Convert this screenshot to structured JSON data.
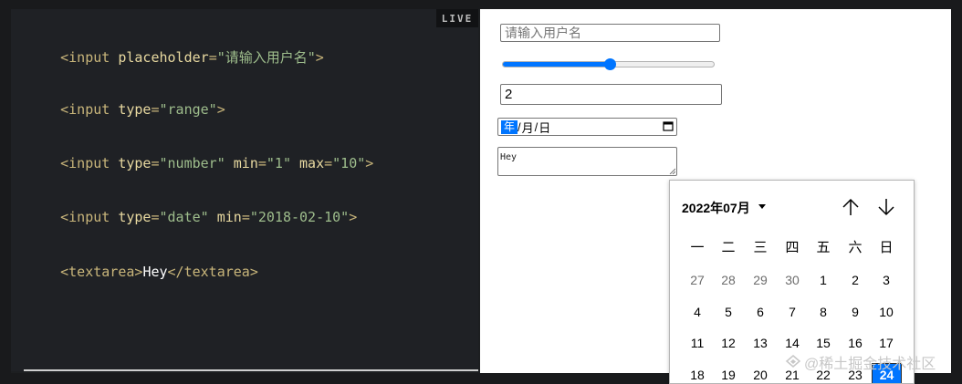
{
  "editor": {
    "lines": [
      {
        "open": "<input ",
        "attr1": "placeholder",
        "eq1": "=",
        "val1": "\"请输入用户名\"",
        "attr2": "",
        "eq2": "",
        "val2": "",
        "attr3": "",
        "eq3": "",
        "val3": "",
        "close": ">"
      },
      {
        "open": "<input ",
        "attr1": "type",
        "eq1": "=",
        "val1": "\"range\"",
        "attr2": "",
        "eq2": "",
        "val2": "",
        "attr3": "",
        "eq3": "",
        "val3": "",
        "close": ">"
      },
      {
        "open": "<input ",
        "attr1": "type",
        "eq1": "=",
        "val1": "\"number\"",
        "attr2": " min",
        "eq2": "=",
        "val2": "\"1\"",
        "attr3": " max",
        "eq3": "=",
        "val3": "\"10\"",
        "close": ">"
      },
      {
        "open": "<input ",
        "attr1": "type",
        "eq1": "=",
        "val1": "\"date\"",
        "attr2": " min",
        "eq2": "=",
        "val2": "\"2018-02-10\"",
        "attr3": "",
        "eq3": "",
        "val3": "",
        "close": ">"
      }
    ],
    "textarea_line": {
      "open": "<textarea>",
      "content": "Hey",
      "close": "</textarea>"
    }
  },
  "live_badge": "LIVE",
  "preview": {
    "text_input": {
      "placeholder": "请输入用户名",
      "value": ""
    },
    "range": {
      "value_fraction": 0.5
    },
    "number_input": {
      "value": "2"
    },
    "date_input": {
      "year": "年",
      "sep": "/",
      "month": "月",
      "day": "日"
    },
    "textarea": {
      "value": "Hey"
    }
  },
  "datepicker": {
    "month_label": "2022年07月",
    "weekdays": [
      "一",
      "二",
      "三",
      "四",
      "五",
      "六",
      "日"
    ],
    "weeks": [
      [
        {
          "d": "27",
          "other": true
        },
        {
          "d": "28",
          "other": true
        },
        {
          "d": "29",
          "other": true
        },
        {
          "d": "30",
          "other": true
        },
        {
          "d": "1"
        },
        {
          "d": "2"
        },
        {
          "d": "3"
        }
      ],
      [
        {
          "d": "4"
        },
        {
          "d": "5"
        },
        {
          "d": "6"
        },
        {
          "d": "7"
        },
        {
          "d": "8"
        },
        {
          "d": "9"
        },
        {
          "d": "10"
        }
      ],
      [
        {
          "d": "11"
        },
        {
          "d": "12"
        },
        {
          "d": "13"
        },
        {
          "d": "14"
        },
        {
          "d": "15"
        },
        {
          "d": "16"
        },
        {
          "d": "17"
        }
      ],
      [
        {
          "d": "18"
        },
        {
          "d": "19"
        },
        {
          "d": "20"
        },
        {
          "d": "21"
        },
        {
          "d": "22"
        },
        {
          "d": "23"
        },
        {
          "d": "24",
          "today": true
        }
      ]
    ],
    "nav": {
      "prev_icon": "arrow-up-icon",
      "next_icon": "arrow-down-icon"
    }
  },
  "watermark": "@稀土掘金技术社区",
  "colors": {
    "accent": "#0075ff",
    "editor_bg": "#1f2125",
    "tag": "#c8b57a",
    "attr": "#e8d9a0",
    "string": "#9ebd8c"
  }
}
